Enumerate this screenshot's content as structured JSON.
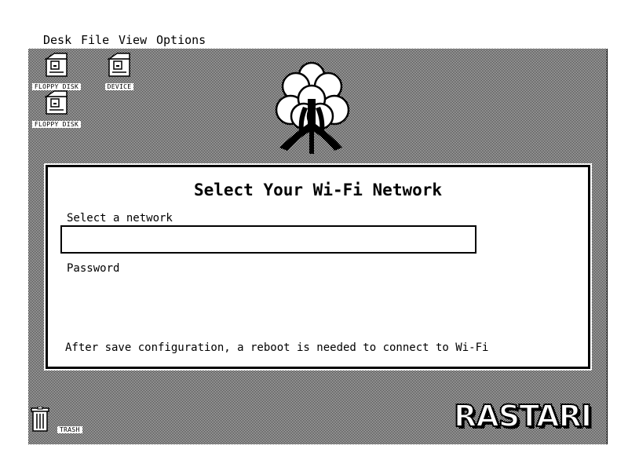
{
  "menu": {
    "items": [
      {
        "label": "Desk"
      },
      {
        "label": "File"
      },
      {
        "label": "View"
      },
      {
        "label": "Options"
      }
    ]
  },
  "desktop": {
    "icons": [
      {
        "label": "FLOPPY DISK",
        "icon": "floppy-disk-icon"
      },
      {
        "label": "DEVICE",
        "icon": "device-icon"
      },
      {
        "label": "FLOPPY DISK",
        "icon": "floppy-disk-icon"
      }
    ],
    "trash": {
      "label": "TRASH",
      "icon": "trash-icon"
    },
    "brand": "RASTARI"
  },
  "dialog": {
    "title": "Select Your Wi-Fi Network",
    "network_label": "Select a network",
    "network_value": "",
    "password_label": "Password",
    "password_value": "",
    "note": "After save configuration, a reboot is needed to connect to Wi-Fi"
  },
  "colors": {
    "foreground": "#000000",
    "background": "#ffffff"
  }
}
